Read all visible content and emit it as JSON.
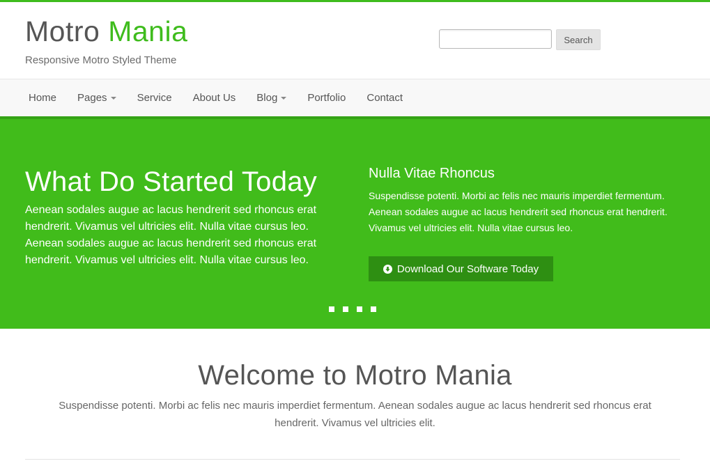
{
  "site": {
    "title_part1": "Motro ",
    "title_part2": "Mania",
    "tagline": "Responsive Motro Styled Theme"
  },
  "search": {
    "value": "",
    "placeholder": "",
    "button_label": "Search"
  },
  "nav": {
    "items": [
      {
        "label": "Home",
        "has_dropdown": false
      },
      {
        "label": "Pages",
        "has_dropdown": true
      },
      {
        "label": "Service",
        "has_dropdown": false
      },
      {
        "label": "About Us",
        "has_dropdown": false
      },
      {
        "label": "Blog",
        "has_dropdown": true
      },
      {
        "label": "Portfolio",
        "has_dropdown": false
      },
      {
        "label": "Contact",
        "has_dropdown": false
      }
    ]
  },
  "hero": {
    "heading": "What Do Started Today",
    "body": "Aenean sodales augue ac lacus hendrerit sed rhoncus erat hendrerit. Vivamus vel ultricies elit. Nulla vitae cursus leo. Aenean sodales augue ac lacus hendrerit sed rhoncus erat hendrerit. Vivamus vel ultricies elit. Nulla vitae cursus leo.",
    "subheading": "Nulla Vitae Rhoncus",
    "subtext": "Suspendisse potenti. Morbi ac felis nec mauris imperdiet fermentum. Aenean sodales augue ac lacus hendrerit sed rhoncus erat hendrerit. Vivamus vel ultricies elit. Nulla vitae cursus leo.",
    "button_label": "Download Our Software Today",
    "button_icon": "circle-arrow-down-icon",
    "slide_count": 4
  },
  "welcome": {
    "title": "Welcome to Motro Mania",
    "text": "Suspendisse potenti. Morbi ac felis nec mauris imperdiet fermentum. Aenean sodales augue ac lacus hendrerit sed rhoncus erat hendrerit. Vivamus vel ultricies elit."
  },
  "colors": {
    "accent": "#3fbc1d",
    "hero_background": "#41bc1b",
    "button_dark": "#2e8f12",
    "text": "#555555",
    "nav_background": "#f8f8f8"
  }
}
